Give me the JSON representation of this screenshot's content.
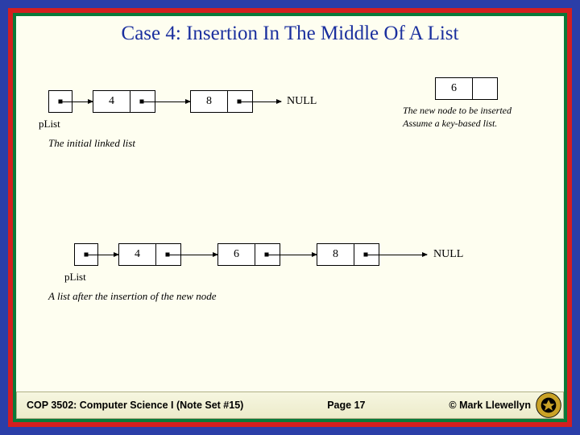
{
  "title": "Case 4: Insertion In The Middle Of A List",
  "initial": {
    "plist_label": "pList",
    "nodes": [
      "4",
      "8"
    ],
    "terminal": "NULL",
    "caption": "The initial linked list"
  },
  "new_node": {
    "value": "6",
    "caption_line1": "The new node to be inserted",
    "caption_line2": "Assume a key-based list."
  },
  "after": {
    "plist_label": "pList",
    "nodes": [
      "4",
      "6",
      "8"
    ],
    "terminal": "NULL",
    "caption": "A list after the insertion of the new node"
  },
  "footer": {
    "course": "COP 3502: Computer Science I   (Note Set #15)",
    "page": "Page 17",
    "author": "© Mark Llewellyn"
  }
}
